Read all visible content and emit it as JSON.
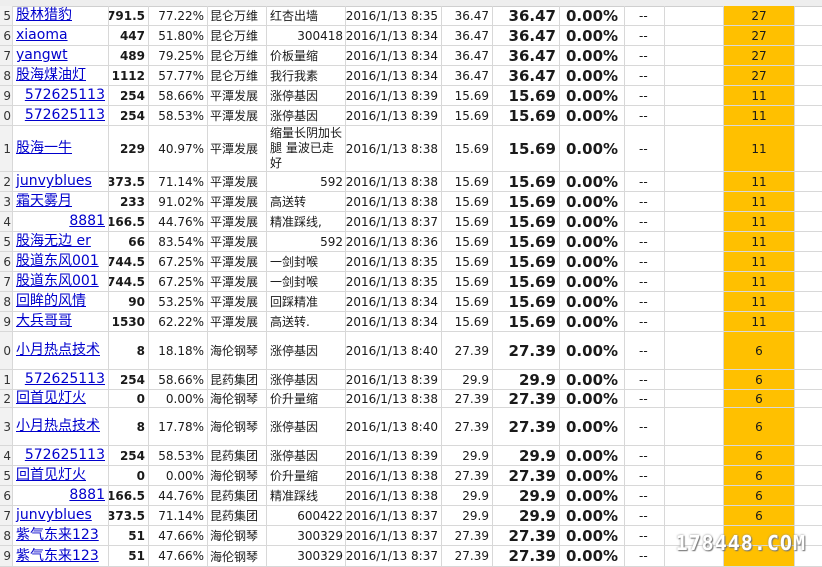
{
  "rows": [
    {
      "rn": "5",
      "name": "股林猎豹",
      "score": "791.5",
      "pct": "77.22%",
      "sector": "昆仑万维",
      "reason": "红杏出墙",
      "time": "2016/1/13 8:35",
      "price": "36.47",
      "close": "36.47",
      "chg": "0.00%",
      "dash": "--",
      "badge": "27"
    },
    {
      "rn": "6",
      "name": "xiaoma",
      "score": "447",
      "pct": "51.80%",
      "sector": "昆仑万维",
      "reason": "300418",
      "time": "2016/1/13 8:34",
      "price": "36.47",
      "close": "36.47",
      "chg": "0.00%",
      "dash": "--",
      "badge": "27"
    },
    {
      "rn": "7",
      "name": "yangwt",
      "score": "489",
      "pct": "79.25%",
      "sector": "昆仑万维",
      "reason": "价板量缩",
      "time": "2016/1/13 8:34",
      "price": "36.47",
      "close": "36.47",
      "chg": "0.00%",
      "dash": "--",
      "badge": "27"
    },
    {
      "rn": "8",
      "name": "股海煤油灯",
      "score": "1112",
      "pct": "57.77%",
      "sector": "昆仑万维",
      "reason": "我行我素",
      "time": "2016/1/13 8:34",
      "price": "36.47",
      "close": "36.47",
      "chg": "0.00%",
      "dash": "--",
      "badge": "27"
    },
    {
      "rn": "9",
      "name": "572625113",
      "score": "254",
      "pct": "58.66%",
      "sector": "平潭发展",
      "reason": "涨停基因",
      "time": "2016/1/13 8:39",
      "price": "15.69",
      "close": "15.69",
      "chg": "0.00%",
      "dash": "--",
      "badge": "11"
    },
    {
      "rn": "0",
      "name": "572625113",
      "score": "254",
      "pct": "58.53%",
      "sector": "平潭发展",
      "reason": "涨停基因",
      "time": "2016/1/13 8:39",
      "price": "15.69",
      "close": "15.69",
      "chg": "0.00%",
      "dash": "--",
      "badge": "11"
    },
    {
      "rn": "1",
      "name": "股海一牛",
      "score": "229",
      "pct": "40.97%",
      "sector": "平潭发展",
      "reason": "缩量长阴加长腿 量波已走好",
      "time": "2016/1/13 8:38",
      "price": "15.69",
      "close": "15.69",
      "chg": "0.00%",
      "dash": "--",
      "badge": "11"
    },
    {
      "rn": "2",
      "name": "junvyblues",
      "score": "373.5",
      "pct": "71.14%",
      "sector": "平潭发展",
      "reason": "592",
      "time": "2016/1/13 8:38",
      "price": "15.69",
      "close": "15.69",
      "chg": "0.00%",
      "dash": "--",
      "badge": "11"
    },
    {
      "rn": "3",
      "name": "霜天雾月",
      "score": "233",
      "pct": "91.02%",
      "sector": "平潭发展",
      "reason": "高送转",
      "time": "2016/1/13 8:38",
      "price": "15.69",
      "close": "15.69",
      "chg": "0.00%",
      "dash": "--",
      "badge": "11"
    },
    {
      "rn": "4",
      "name": "8881",
      "score": "166.5",
      "pct": "44.76%",
      "sector": "平潭发展",
      "reason": "精准踩线,",
      "time": "2016/1/13 8:37",
      "price": "15.69",
      "close": "15.69",
      "chg": "0.00%",
      "dash": "--",
      "badge": "11"
    },
    {
      "rn": "5",
      "name": "股海无边 er",
      "score": "66",
      "pct": "83.54%",
      "sector": "平潭发展",
      "reason": "592",
      "time": "2016/1/13 8:36",
      "price": "15.69",
      "close": "15.69",
      "chg": "0.00%",
      "dash": "--",
      "badge": "11"
    },
    {
      "rn": "6",
      "name": "股道东风001",
      "score": "744.5",
      "pct": "67.25%",
      "sector": "平潭发展",
      "reason": "一剑封喉",
      "time": "2016/1/13 8:35",
      "price": "15.69",
      "close": "15.69",
      "chg": "0.00%",
      "dash": "--",
      "badge": "11"
    },
    {
      "rn": "7",
      "name": "股道东风001",
      "score": "744.5",
      "pct": "67.25%",
      "sector": "平潭发展",
      "reason": "一剑封喉",
      "time": "2016/1/13 8:35",
      "price": "15.69",
      "close": "15.69",
      "chg": "0.00%",
      "dash": "--",
      "badge": "11"
    },
    {
      "rn": "8",
      "name": "回眸的风情",
      "score": "90",
      "pct": "53.25%",
      "sector": "平潭发展",
      "reason": "回踩精准",
      "time": "2016/1/13 8:34",
      "price": "15.69",
      "close": "15.69",
      "chg": "0.00%",
      "dash": "--",
      "badge": "11"
    },
    {
      "rn": "9",
      "name": "大兵哥哥",
      "score": "1530",
      "pct": "62.22%",
      "sector": "平潭发展",
      "reason": "高送转.",
      "time": "2016/1/13 8:34",
      "price": "15.69",
      "close": "15.69",
      "chg": "0.00%",
      "dash": "--",
      "badge": "11"
    },
    {
      "rn": "0",
      "name": "小月热点技术",
      "score": "8",
      "pct": "18.18%",
      "sector": "海伦钢琴",
      "reason": "涨停基因",
      "time": "2016/1/13 8:40",
      "price": "27.39",
      "close": "27.39",
      "chg": "0.00%",
      "dash": "--",
      "badge": "6"
    },
    {
      "rn": "1",
      "name": "572625113",
      "score": "254",
      "pct": "58.66%",
      "sector": "昆药集团",
      "reason": "涨停基因",
      "time": "2016/1/13 8:39",
      "price": "29.9",
      "close": "29.9",
      "chg": "0.00%",
      "dash": "--",
      "badge": "6"
    },
    {
      "rn": "2",
      "name": "回首见灯火",
      "score": "0",
      "pct": "0.00%",
      "sector": "海伦钢琴",
      "reason": "价升量缩",
      "time": "2016/1/13 8:38",
      "price": "27.39",
      "close": "27.39",
      "chg": "0.00%",
      "dash": "--",
      "badge": "6"
    },
    {
      "rn": "3",
      "name": "小月热点技术",
      "score": "8",
      "pct": "17.78%",
      "sector": "海伦钢琴",
      "reason": "涨停基因",
      "time": "2016/1/13 8:40",
      "price": "27.39",
      "close": "27.39",
      "chg": "0.00%",
      "dash": "--",
      "badge": "6"
    },
    {
      "rn": "4",
      "name": "572625113",
      "score": "254",
      "pct": "58.53%",
      "sector": "昆药集团",
      "reason": "涨停基因",
      "time": "2016/1/13 8:39",
      "price": "29.9",
      "close": "29.9",
      "chg": "0.00%",
      "dash": "--",
      "badge": "6"
    },
    {
      "rn": "5",
      "name": "回首见灯火",
      "score": "0",
      "pct": "0.00%",
      "sector": "海伦钢琴",
      "reason": "价升量缩",
      "time": "2016/1/13 8:38",
      "price": "27.39",
      "close": "27.39",
      "chg": "0.00%",
      "dash": "--",
      "badge": "6"
    },
    {
      "rn": "6",
      "name": "8881",
      "score": "166.5",
      "pct": "44.76%",
      "sector": "昆药集团",
      "reason": "精准踩线",
      "time": "2016/1/13 8:38",
      "price": "29.9",
      "close": "29.9",
      "chg": "0.00%",
      "dash": "--",
      "badge": "6"
    },
    {
      "rn": "7",
      "name": "junvyblues",
      "score": "373.5",
      "pct": "71.14%",
      "sector": "昆药集团",
      "reason": "600422",
      "time": "2016/1/13 8:37",
      "price": "29.9",
      "close": "29.9",
      "chg": "0.00%",
      "dash": "--",
      "badge": "6"
    },
    {
      "rn": "8",
      "name": "紫气东来123",
      "score": "51",
      "pct": "47.66%",
      "sector": "海伦钢琴",
      "reason": "300329",
      "time": "2016/1/13 8:37",
      "price": "27.39",
      "close": "27.39",
      "chg": "0.00%",
      "dash": "--",
      "badge": ""
    },
    {
      "rn": "9",
      "name": "紫气东来123",
      "score": "51",
      "pct": "47.66%",
      "sector": "海伦钢琴",
      "reason": "300329",
      "time": "2016/1/13 8:37",
      "price": "27.39",
      "close": "27.39",
      "chg": "0.00%",
      "dash": "--",
      "badge": ""
    }
  ],
  "watermark": "178448.COM",
  "colors": {
    "link": "#0000cc",
    "highlight": "#ffc000",
    "grid": "#d8d8d8"
  }
}
